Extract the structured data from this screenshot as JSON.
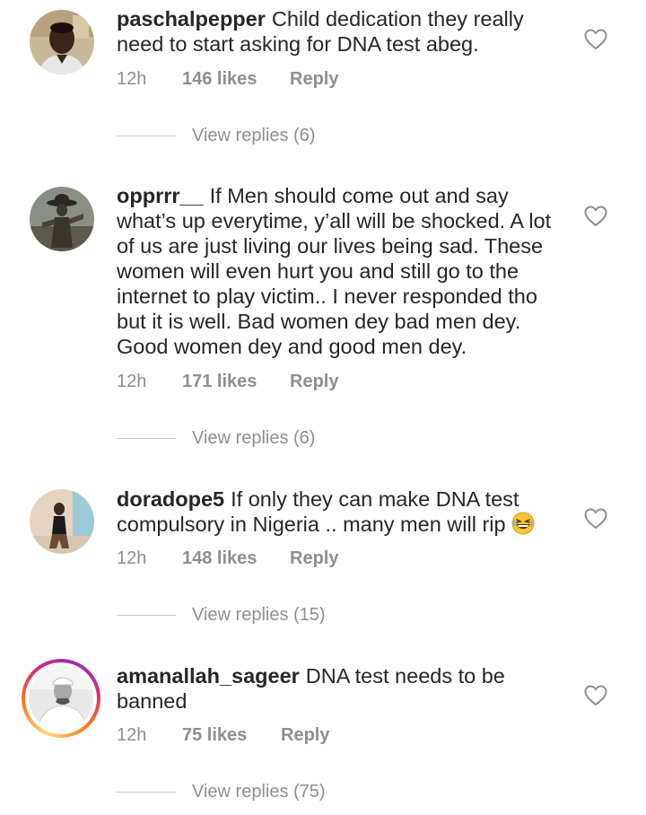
{
  "comments": [
    {
      "username": "paschalpepper",
      "text": "Child dedication they really need to start asking for DNA test abeg.",
      "time": "12h",
      "likes": "146 likes",
      "reply": "Reply",
      "view_replies": "View replies (6)",
      "avatar_icon": "profile-photo"
    },
    {
      "username": "opprrr__",
      "text": "If Men should come out and say what’s up everytime, y’all will be shocked. A lot of us are just living our lives being sad. These women will even hurt you and still go to the internet to play victim.. I never responded tho but it is well. Bad women dey bad men dey. Good women dey and good men dey.",
      "time": "12h",
      "likes": "171 likes",
      "reply": "Reply",
      "view_replies": "View replies (6)",
      "avatar_icon": "profile-photo"
    },
    {
      "username": "doradope5",
      "text": "If only they can make DNA test compulsory in Nigeria .. many men will rip",
      "emoji": "grinning-squinting-face-emoji",
      "time": "12h",
      "likes": "148 likes",
      "reply": "Reply",
      "view_replies": "View replies (15)",
      "avatar_icon": "profile-photo"
    },
    {
      "username": "amanallah_sageer",
      "text": "DNA test needs to be banned",
      "time": "12h",
      "likes": "75 likes",
      "reply": "Reply",
      "view_replies": "View replies (75)",
      "avatar_icon": "profile-photo-with-story-ring"
    }
  ],
  "colors": {
    "text": "#262626",
    "secondary": "#8e8e8e",
    "divider": "#c7c7c7",
    "background": "#ffffff"
  },
  "icons": {
    "like": "heart-outline-icon"
  }
}
